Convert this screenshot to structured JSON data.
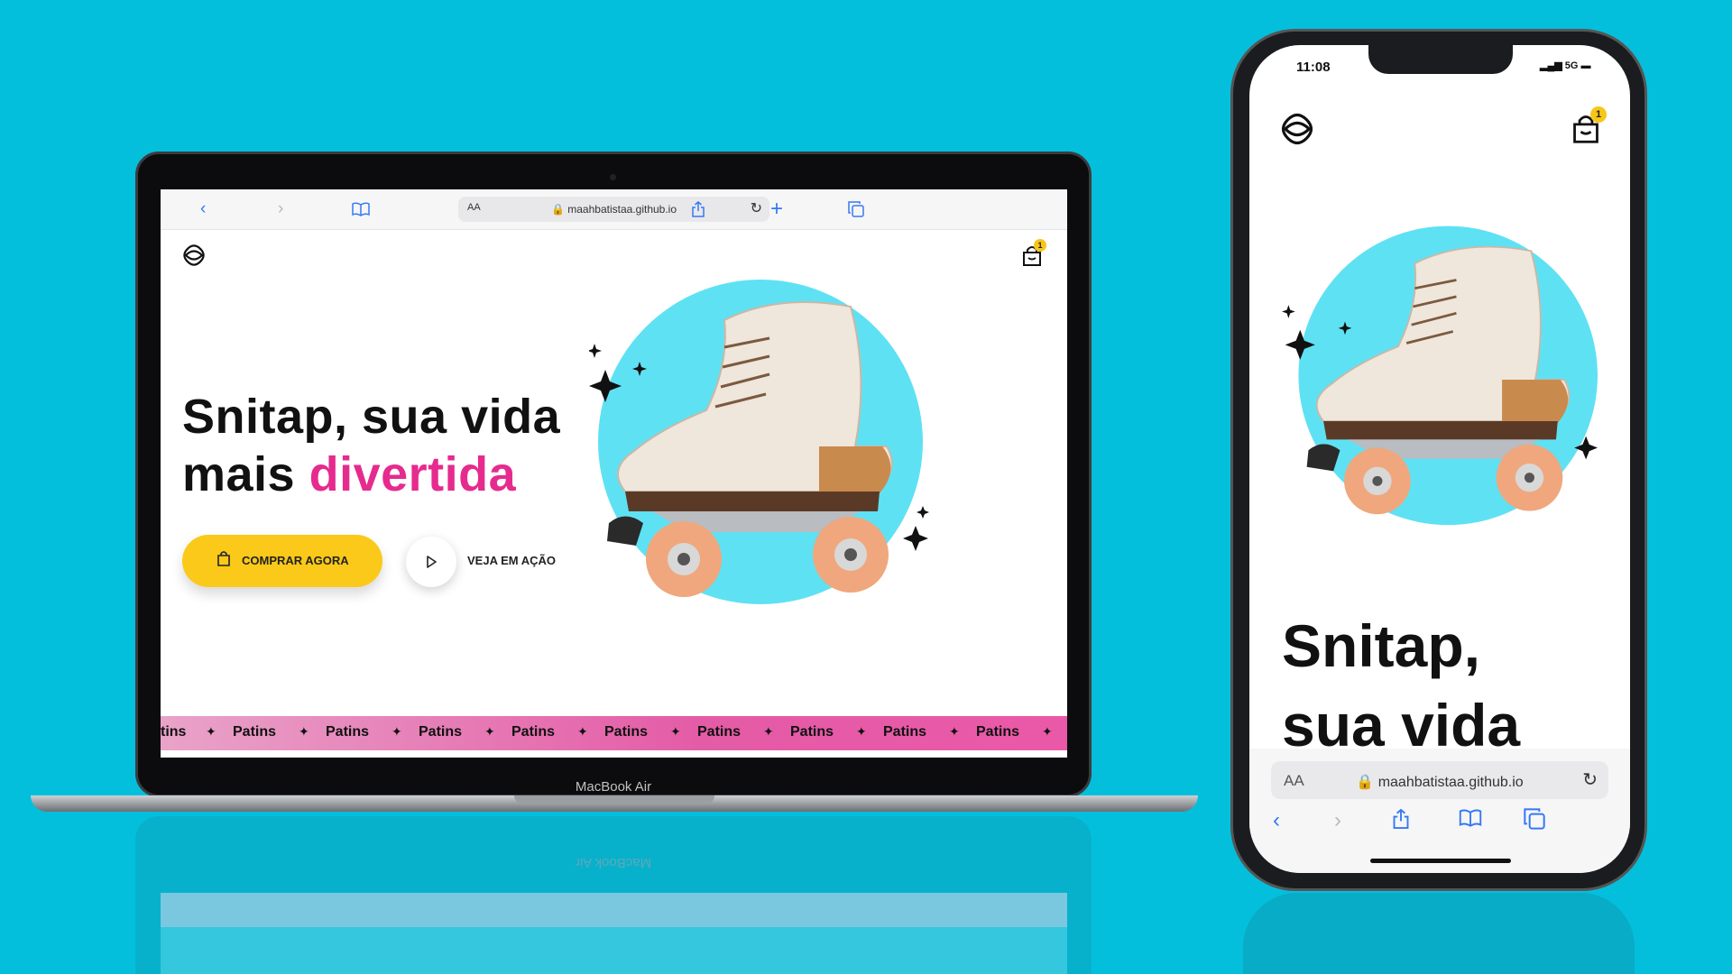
{
  "laptop": {
    "device_label": "MacBook Air",
    "browser": {
      "text_size_label": "AA",
      "url": "maahbatistaa.github.io",
      "icons": [
        "back-icon",
        "forward-icon",
        "bookmarks-icon",
        "share-icon",
        "new-tab-icon",
        "tabs-icon",
        "reload-icon",
        "lock-icon"
      ]
    },
    "site": {
      "cart_count": "1",
      "headline_line1": "Snitap, sua vida",
      "headline_line2_prefix": "mais ",
      "headline_line2_highlight": "divertida",
      "buy_button_label": "COMPRAR AGORA",
      "watch_label": "VEJA EM AÇÃO",
      "marquee_partial": "tins",
      "marquee_items": [
        "Patins",
        "Patins",
        "Patins",
        "Patins",
        "Patins",
        "Patins",
        "Patins",
        "Patins",
        "Patins"
      ],
      "marquee_separator": "✦"
    }
  },
  "phone": {
    "time": "11:08",
    "signal_label": "5G",
    "cart_count": "1",
    "headline_line1": "Snitap,",
    "headline_line2": "sua vida",
    "browser": {
      "text_size_label": "AA",
      "url": "maahbatistaa.github.io"
    }
  },
  "colors": {
    "background": "#04bfdc",
    "accent_yellow": "#fbc91a",
    "accent_pink": "#e62b8e",
    "circle_cyan": "#5fe1f4"
  }
}
